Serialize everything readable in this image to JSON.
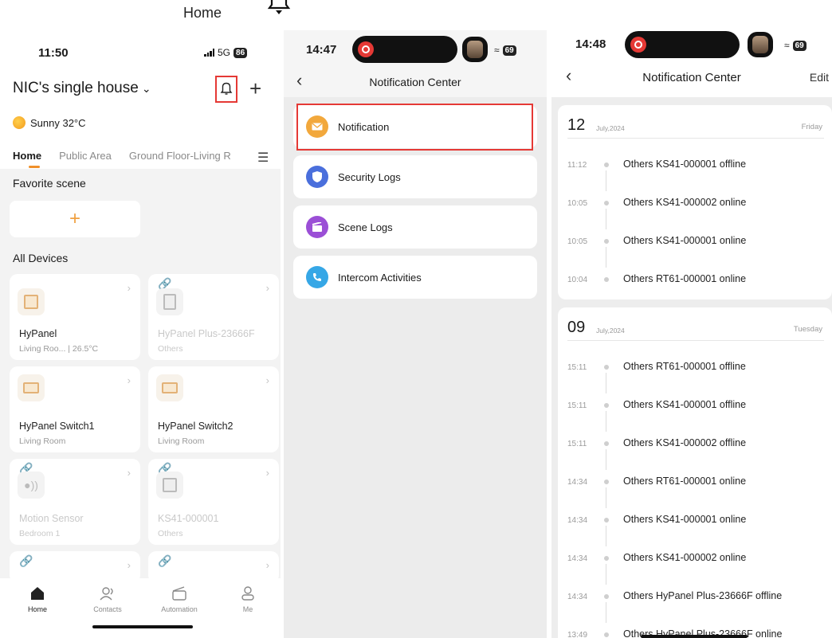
{
  "caption": {
    "label": "Home"
  },
  "home": {
    "status": {
      "time": "11:50",
      "network": "5G",
      "battery": "86"
    },
    "house_name": "NIC's single house",
    "weather": "Sunny 32°C",
    "tabs": [
      "Home",
      "Public Area",
      "Ground Floor-Living R"
    ],
    "favorite_label": "Favorite scene",
    "all_devices_label": "All Devices",
    "devices": [
      {
        "name": "HyPanel",
        "room": "Living Roo... | 26.5°C",
        "online": true
      },
      {
        "name": "HyPanel Plus-23666F",
        "room": "Others",
        "online": false
      },
      {
        "name": "HyPanel Switch1",
        "room": "Living Room",
        "online": true
      },
      {
        "name": "HyPanel Switch2",
        "room": "Living Room",
        "online": true
      },
      {
        "name": "Motion Sensor",
        "room": "Bedroom 1",
        "online": false
      },
      {
        "name": "KS41-000001",
        "room": "Others",
        "online": false
      }
    ],
    "nav": [
      "Home",
      "Contacts",
      "Automation",
      "Me"
    ]
  },
  "categories": {
    "status": {
      "time": "14:47",
      "battery": "69"
    },
    "title": "Notification Center",
    "items": [
      "Notification",
      "Security Logs",
      "Scene Logs",
      "Intercom Activities"
    ]
  },
  "center": {
    "status": {
      "time": "14:48",
      "battery": "69"
    },
    "title": "Notification Center",
    "edit": "Edit",
    "groups": [
      {
        "day": "12",
        "month": "July,2024",
        "weekday": "Friday",
        "entries": [
          {
            "time": "11:12",
            "msg": "Others KS41-000001 offline"
          },
          {
            "time": "10:05",
            "msg": "Others KS41-000002 online"
          },
          {
            "time": "10:05",
            "msg": "Others KS41-000001 online"
          },
          {
            "time": "10:04",
            "msg": "Others RT61-000001 online"
          }
        ]
      },
      {
        "day": "09",
        "month": "July,2024",
        "weekday": "Tuesday",
        "entries": [
          {
            "time": "15:11",
            "msg": "Others RT61-000001 offline"
          },
          {
            "time": "15:11",
            "msg": "Others KS41-000001 offline"
          },
          {
            "time": "15:11",
            "msg": "Others KS41-000002 offline"
          },
          {
            "time": "14:34",
            "msg": "Others RT61-000001 online"
          },
          {
            "time": "14:34",
            "msg": "Others KS41-000001 online"
          },
          {
            "time": "14:34",
            "msg": "Others KS41-000002 online"
          },
          {
            "time": "14:34",
            "msg": "Others HyPanel Plus-23666F offline"
          },
          {
            "time": "13:49",
            "msg": "Others HyPanel Plus-23666F online"
          }
        ]
      }
    ]
  },
  "colors": {
    "accent": "#f0902a",
    "highlight": "#e53935"
  }
}
